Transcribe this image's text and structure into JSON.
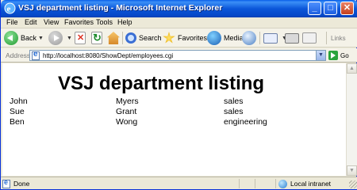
{
  "window": {
    "title": "VSJ department listing - Microsoft Internet Explorer"
  },
  "menu": [
    "File",
    "Edit",
    "View",
    "Favorites",
    "Tools",
    "Help"
  ],
  "toolbar": {
    "back_label": "Back",
    "search_label": "Search",
    "favorites_label": "Favorites",
    "media_label": "Media",
    "links_label": "Links"
  },
  "address": {
    "label": "Address",
    "url": "http://localhost:8080/ShowDept/employees.cgi",
    "go_label": "Go"
  },
  "page": {
    "heading": "VSJ department listing",
    "rows": [
      [
        "John",
        "Myers",
        "sales"
      ],
      [
        "Sue",
        "Grant",
        "sales"
      ],
      [
        "Ben",
        "Wong",
        "engineering"
      ]
    ]
  },
  "status": {
    "text": "Done",
    "zone": "Local intranet"
  }
}
